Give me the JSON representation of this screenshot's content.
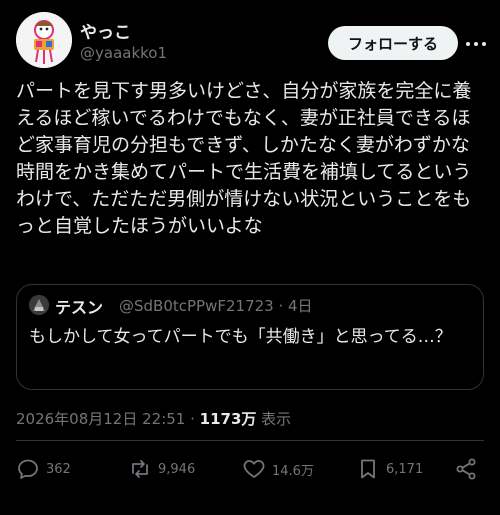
{
  "user": {
    "display_name": "やっこ",
    "handle": "@yaaakko1",
    "avatar_icon": "cartoon-character-avatar"
  },
  "follow_label": "フォローする",
  "more_icon": "more-icon",
  "tweet_text": "パートを見下す男多いけどさ、自分が家族を完全に養えるほど稼いでるわけでもなく、妻が正社員できるほど家事育児の分担もできず、しかたなく妻がわずかな時間をかき集めてパートで生活費を補填してるというわけで、ただただ男側が情けない状況ということをもっと自覚したほうがいいよな",
  "quote": {
    "name": "テスン",
    "handle_time": "@SdB0tcPPwF21723 · 4日",
    "text": "もしかして女ってパートでも「共働き」と思ってる…？"
  },
  "meta": {
    "timestamp": "2026年08月12日 22:51",
    "separator": " · ",
    "views": "1173万",
    "views_label": " 表示"
  },
  "actions": {
    "replies": "362",
    "retweets": "9,946",
    "likes": "14.6万",
    "bookmarks": "6,171"
  },
  "colors": {
    "background": "#000000",
    "text": "#e7e9ea",
    "muted": "#71767b",
    "border": "#2f3336",
    "follow_bg": "#eff3f4"
  }
}
